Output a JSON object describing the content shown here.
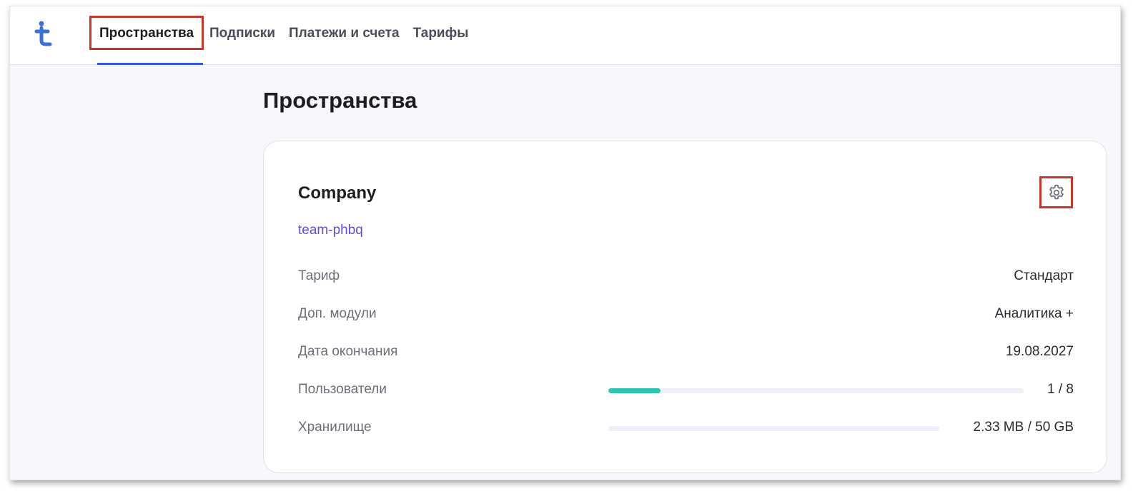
{
  "nav": {
    "items": [
      "Пространства",
      "Подписки",
      "Платежи и счета",
      "Тарифы"
    ],
    "active_index": 0
  },
  "page": {
    "title": "Пространства"
  },
  "space": {
    "name": "Company",
    "slug": "team-phbq",
    "rows": [
      {
        "label": "Тариф",
        "value": "Стандарт"
      },
      {
        "label": "Доп. модули",
        "value": "Аналитика +"
      },
      {
        "label": "Дата окончания",
        "value": "19.08.2027"
      },
      {
        "label": "Пользователи",
        "value": "1 / 8",
        "progress": 0.125
      },
      {
        "label": "Хранилище",
        "value": "2.33 MB / 50 GB",
        "progress": 5e-05
      }
    ]
  },
  "colors": {
    "accent": "#3358e0",
    "slug": "#5b4fd6",
    "progress_fill": "#2ec4b0",
    "highlight": "#c0392b"
  },
  "icons": {
    "logo": "t-logo-icon",
    "settings": "gear-icon"
  }
}
